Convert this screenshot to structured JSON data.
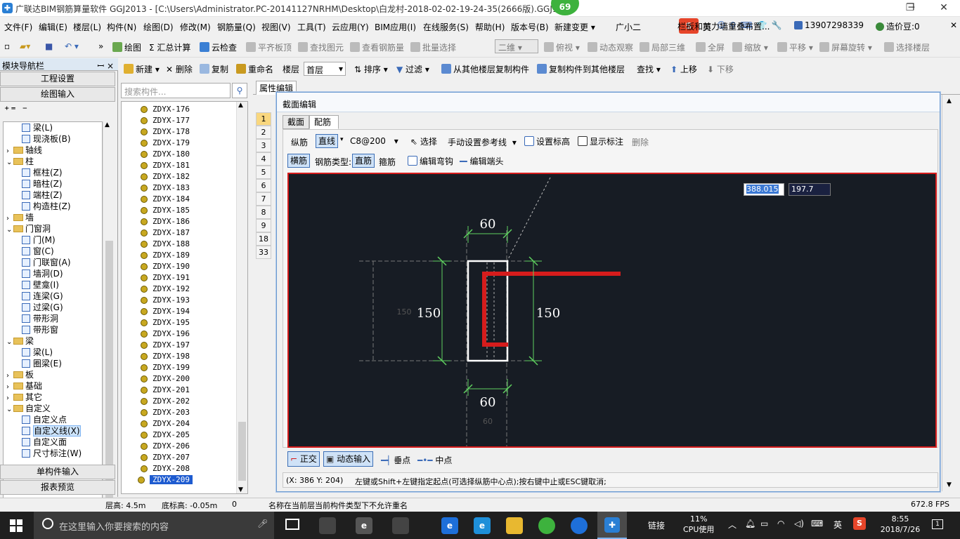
{
  "titlebar": {
    "title": "广联达BIM钢筋算量软件 GGJ2013 - [C:\\Users\\Administrator.PC-20141127NRHM\\Desktop\\白龙村-2018-02-02-19-24-35(2666版).GGJ12",
    "badge": "69",
    "minimize": "─",
    "restore": "❐",
    "close": "✕"
  },
  "menubar": {
    "items": [
      "文件(F)",
      "编辑(E)",
      "楼层(L)",
      "构件(N)",
      "绘图(D)",
      "修改(M)",
      "钢筋量(Q)",
      "视图(V)",
      "工具(T)",
      "云应用(Y)",
      "BIM应用(I)",
      "在线服务(S)",
      "帮助(H)",
      "版本号(B)",
      "新建变更 ▾",
      "广小二"
    ],
    "notice": "栏板和剪力墙重叠布置...",
    "phone": "13907298339",
    "price": "造价豆:0",
    "ime": "英"
  },
  "toolbar1": {
    "items": [
      "绘图",
      "Σ 汇总计算",
      "云检查",
      "平齐板顶",
      "查找图元",
      "查看钢筋量",
      "批量选择",
      "二维",
      "俯视",
      "动态观察",
      "局部三维",
      "全屏",
      "缩放",
      "平移",
      "屏幕旋转",
      "选择楼层"
    ]
  },
  "navpanel": {
    "title": "模块导航栏",
    "pin": "ꟷ ×",
    "btn_settings": "工程设置",
    "btn_draw": "绘图输入",
    "btn_single": "单构件输入",
    "btn_report": "报表预览",
    "tree": [
      {
        "label": "梁(L)",
        "kind": "leaf",
        "indent": 2
      },
      {
        "label": "现浇板(B)",
        "kind": "leaf",
        "indent": 2
      },
      {
        "label": "轴线",
        "kind": "folder",
        "indent": 0,
        "toggle": "›"
      },
      {
        "label": "柱",
        "kind": "folder",
        "indent": 0,
        "toggle": "⌄"
      },
      {
        "label": "框柱(Z)",
        "kind": "leaf",
        "indent": 2
      },
      {
        "label": "暗柱(Z)",
        "kind": "leaf",
        "indent": 2
      },
      {
        "label": "端柱(Z)",
        "kind": "leaf",
        "indent": 2
      },
      {
        "label": "构造柱(Z)",
        "kind": "leaf",
        "indent": 2
      },
      {
        "label": "墙",
        "kind": "folder",
        "indent": 0,
        "toggle": "›"
      },
      {
        "label": "门窗洞",
        "kind": "folder",
        "indent": 0,
        "toggle": "⌄"
      },
      {
        "label": "门(M)",
        "kind": "leaf",
        "indent": 2
      },
      {
        "label": "窗(C)",
        "kind": "leaf",
        "indent": 2
      },
      {
        "label": "门联窗(A)",
        "kind": "leaf",
        "indent": 2
      },
      {
        "label": "墙洞(D)",
        "kind": "leaf",
        "indent": 2
      },
      {
        "label": "壁龛(I)",
        "kind": "leaf",
        "indent": 2
      },
      {
        "label": "连梁(G)",
        "kind": "leaf",
        "indent": 2
      },
      {
        "label": "过梁(G)",
        "kind": "leaf",
        "indent": 2
      },
      {
        "label": "带形洞",
        "kind": "leaf",
        "indent": 2
      },
      {
        "label": "带形窗",
        "kind": "leaf",
        "indent": 2
      },
      {
        "label": "梁",
        "kind": "folder",
        "indent": 0,
        "toggle": "⌄"
      },
      {
        "label": "梁(L)",
        "kind": "leaf",
        "indent": 2
      },
      {
        "label": "圈梁(E)",
        "kind": "leaf",
        "indent": 2
      },
      {
        "label": "板",
        "kind": "folder",
        "indent": 0,
        "toggle": "›"
      },
      {
        "label": "基础",
        "kind": "folder",
        "indent": 0,
        "toggle": "›"
      },
      {
        "label": "其它",
        "kind": "folder",
        "indent": 0,
        "toggle": "›"
      },
      {
        "label": "自定义",
        "kind": "folder",
        "indent": 0,
        "toggle": "⌄"
      },
      {
        "label": "自定义点",
        "kind": "leaf",
        "indent": 2
      },
      {
        "label": "自定义线(X)",
        "kind": "leaf",
        "indent": 2,
        "selected": true
      },
      {
        "label": "自定义面",
        "kind": "leaf",
        "indent": 2
      },
      {
        "label": "尺寸标注(W)",
        "kind": "leaf",
        "indent": 2
      }
    ]
  },
  "toolbar2": {
    "new": "新建",
    "delete": "删除",
    "copy": "复制",
    "rename": "重命名",
    "floor_label": "楼层",
    "floor_value": "首层",
    "sort": "排序",
    "filter": "过滤",
    "copy_from": "从其他楼层复制构件",
    "copy_to": "复制构件到其他楼层",
    "find": "查找",
    "up": "上移",
    "down": "下移"
  },
  "complist": {
    "search_placeholder": "搜索构件...",
    "items": [
      "ZDYX-176",
      "ZDYX-177",
      "ZDYX-178",
      "ZDYX-179",
      "ZDYX-180",
      "ZDYX-181",
      "ZDYX-182",
      "ZDYX-183",
      "ZDYX-184",
      "ZDYX-185",
      "ZDYX-186",
      "ZDYX-187",
      "ZDYX-188",
      "ZDYX-189",
      "ZDYX-190",
      "ZDYX-191",
      "ZDYX-192",
      "ZDYX-193",
      "ZDYX-194",
      "ZDYX-195",
      "ZDYX-196",
      "ZDYX-197",
      "ZDYX-198",
      "ZDYX-199",
      "ZDYX-200",
      "ZDYX-201",
      "ZDYX-202",
      "ZDYX-203",
      "ZDYX-204",
      "ZDYX-205",
      "ZDYX-206",
      "ZDYX-207",
      "ZDYX-208",
      "ZDYX-209"
    ],
    "selected": "ZDYX-209"
  },
  "props": {
    "tab": "属性编辑",
    "rows": [
      "1",
      "2",
      "3",
      "4",
      "5",
      "6",
      "7",
      "8",
      "9",
      "18",
      "33"
    ]
  },
  "dialog": {
    "title": "截面编辑",
    "tabs": [
      "截面",
      "配筋"
    ],
    "row1": {
      "longitudinal": "纵筋",
      "line": "直线",
      "spec": "C8@200",
      "select": "选择",
      "manual_ref": "手动设置参考线",
      "set_elev": "设置标高",
      "show_dim": "显示标注",
      "delete": "删除"
    },
    "row2": {
      "transverse": "横筋",
      "type_label": "钢筋类型:",
      "straight": "直筋",
      "stirrup": "箍筋",
      "edit_hook": "编辑弯钩",
      "edit_end": "编辑端头"
    },
    "coord_x": "388.015",
    "coord_y": "197.7",
    "dims": {
      "top": "60",
      "bottom": "60",
      "left": "150",
      "right": "150",
      "ghost_left": "150",
      "ghost_bottom": "60"
    },
    "bottom": {
      "ortho": "正交",
      "dynamic": "动态输入",
      "perp": "垂点",
      "mid": "中点"
    },
    "status_coord": "(X: 386 Y: 204)",
    "status_hint": "左键或Shift+左键指定起点(可选择纵筋中心点);按右键中止或ESC键取消;"
  },
  "statusbar": {
    "floor_h": "层高: 4.5m",
    "bottom_elev": "底标高: -0.05m",
    "zero": "0",
    "message": "名称在当前层当前构件类型下不允许重名",
    "fps": "672.8 FPS"
  },
  "taskbar": {
    "search": "在这里输入你要搜索的内容",
    "link": "链接",
    "cpu_pct": "11%",
    "cpu_label": "CPU使用",
    "ime": "英",
    "time": "8:55",
    "date": "2018/7/26",
    "notif": "1"
  },
  "colors": {
    "accent": "#2a7fd4",
    "canvas_bg": "#171c24",
    "canvas_border": "#d61c1c",
    "rebar": "#d61c1c",
    "dim": "#5fd15f"
  }
}
